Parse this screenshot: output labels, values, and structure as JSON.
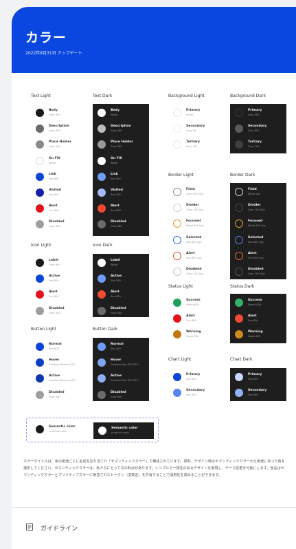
{
  "header": {
    "title": "カラー",
    "subtitle": "2022年8月31日 アップデート"
  },
  "groups": {
    "text_light": {
      "title": "Text Light"
    },
    "text_dark": {
      "title": "Text Dark"
    },
    "bg_light": {
      "title": "Background Light"
    },
    "bg_dark": {
      "title": "Background Dark"
    },
    "border_light": {
      "title": "Border Light"
    },
    "border_dark": {
      "title": "Border Dark"
    },
    "icon_light": {
      "title": "Icon Light"
    },
    "icon_dark": {
      "title": "Icon Dark"
    },
    "status_light": {
      "title": "Status Light"
    },
    "status_dark": {
      "title": "Status Dark"
    },
    "button_light": {
      "title": "Button Light"
    },
    "button_dark": {
      "title": "Button Dark"
    },
    "chart_light": {
      "title": "Chart Light"
    },
    "chart_dark": {
      "title": "Chart Dark"
    }
  },
  "swatches": {
    "text_light": [
      {
        "name": "Body",
        "sub": "Gray 900",
        "color": "#1a1a1a"
      },
      {
        "name": "Description",
        "sub": "Gray 600",
        "color": "#6b6b6b"
      },
      {
        "name": "Place Holder",
        "sub": "Gray 500",
        "color": "#8a8a8a"
      },
      {
        "name": "On Fill",
        "sub": "White",
        "color": "#ffffff",
        "ring": "#dddddd"
      },
      {
        "name": "Link",
        "sub": "Sea 800",
        "color": "#0b45d8"
      },
      {
        "name": "Visited",
        "sub": "Sea 900",
        "color": "#1520a8"
      },
      {
        "name": "Alert",
        "sub": "Sun 800",
        "color": "#e3131d"
      },
      {
        "name": "Disabled",
        "sub": "Gray 400",
        "color": "#9e9e9e"
      }
    ],
    "text_dark": [
      {
        "name": "Body",
        "sub": "White",
        "color": "#ffffff"
      },
      {
        "name": "Description",
        "sub": "Gray 400",
        "color": "#bdbdbd"
      },
      {
        "name": "Place Holder",
        "sub": "Gray 500",
        "color": "#9a9a9a"
      },
      {
        "name": "On Fill",
        "sub": "White",
        "color": "#ffffff"
      },
      {
        "name": "Link",
        "sub": "Sea 300",
        "color": "#6f9cf7"
      },
      {
        "name": "Visited",
        "sub": "Sea 200",
        "color": "#a6b9f7"
      },
      {
        "name": "Alert",
        "sub": "Sun 600",
        "color": "#f04b32"
      },
      {
        "name": "Disabled",
        "sub": "Gray 600",
        "color": "#6b6b6b"
      }
    ],
    "bg_light": [
      {
        "name": "Primary",
        "sub": "White",
        "color": "#ffffff",
        "ring": "#e6e6e6"
      },
      {
        "name": "Secondary",
        "sub": "Gray 50",
        "color": "#f5f5f5",
        "ring": "#eeeeee"
      },
      {
        "name": "Tertiary",
        "sub": "Gray 100",
        "color": "#eeeeee",
        "ring": "#e6e6e6"
      }
    ],
    "bg_dark": [
      {
        "name": "Primary",
        "sub": "Gray 900",
        "color": "#1e1e1e",
        "ring": "#3a3a3a"
      },
      {
        "name": "Secondary",
        "sub": "Gray 800",
        "color": "#5a5a5a"
      },
      {
        "name": "Tertiary",
        "sub": "Gray 700",
        "color": "#3f3f3f"
      }
    ],
    "border_light": [
      {
        "name": "Field",
        "sub": "Trans 600 Gys",
        "color": "#ffffff",
        "ring": "#8a8a8a"
      },
      {
        "name": "Divider",
        "sub": "Trans 300 Gys",
        "color": "#ffffff",
        "ring": "#d0d0d0"
      },
      {
        "name": "Focused",
        "sub": "Wood 600 Gys",
        "color": "#ffffff",
        "ring": "#d99a1e"
      },
      {
        "name": "Selected",
        "sub": "Sea 600 Gys",
        "color": "#ffffff",
        "ring": "#2f64e6"
      },
      {
        "name": "Alert",
        "sub": "Sun 600 Gys",
        "color": "#ffffff",
        "ring": "#e84a3a"
      },
      {
        "name": "Disabled",
        "sub": "Trans 300 Gys",
        "color": "#ffffff",
        "ring": "#c4c4c4"
      }
    ],
    "border_dark": [
      {
        "name": "Field",
        "sub": "White Gys",
        "color": "#1e1e1e",
        "ring": "#d0d0d0"
      },
      {
        "name": "Divider",
        "sub": "Gray 700 Gys",
        "color": "#1e1e1e",
        "ring": "#4a4a4a"
      },
      {
        "name": "Focused",
        "sub": "Wood 400 Gys",
        "color": "#1e1e1e",
        "ring": "#d8a431"
      },
      {
        "name": "Selected",
        "sub": "Sea 400 Gys",
        "color": "#1e1e1e",
        "ring": "#5a7fe6"
      },
      {
        "name": "Alert",
        "sub": "Sun 500 Gys",
        "color": "#1e1e1e",
        "ring": "#e0683f"
      },
      {
        "name": "Disabled",
        "sub": "Gray 700 Gys",
        "color": "#1e1e1e",
        "ring": "#555555"
      }
    ],
    "icon_light": [
      {
        "name": "Label",
        "sub": "Gray 900",
        "color": "#1a1a1a"
      },
      {
        "name": "Active",
        "sub": "Sea 800",
        "color": "#0b45d8"
      },
      {
        "name": "Alert",
        "sub": "Sun 800",
        "color": "#e3131d"
      },
      {
        "name": "Disabled",
        "sub": "Gray 400",
        "color": "#9e9e9e"
      }
    ],
    "icon_dark": [
      {
        "name": "Label",
        "sub": "White",
        "color": "#ffffff"
      },
      {
        "name": "Active",
        "sub": "Sea 300",
        "color": "#6f9cf7"
      },
      {
        "name": "Alert",
        "sub": "Sun 600",
        "color": "#f04b32"
      },
      {
        "name": "Disabled",
        "sub": "Gray 600",
        "color": "#6b6b6b"
      }
    ],
    "status_light": [
      {
        "name": "Success",
        "sub": "Forest 600",
        "color": "#1ca05c"
      },
      {
        "name": "Alert",
        "sub": "Sun 800",
        "color": "#e3131d"
      },
      {
        "name": "Warning",
        "sub": "Wood 600",
        "color": "#c5760f"
      }
    ],
    "status_dark": [
      {
        "name": "Success",
        "sub": "Forest 400",
        "color": "#2fb26a"
      },
      {
        "name": "Alert",
        "sub": "Sun 600",
        "color": "#f04b32"
      },
      {
        "name": "Warning",
        "sub": "Wood 400",
        "color": "#d08a1e"
      }
    ],
    "button_light": [
      {
        "name": "Normal",
        "sub": "Sea 800",
        "color": "#0b45d8"
      },
      {
        "name": "Hover",
        "sub": "Gradient Normal 20%",
        "color": "#0a3ec4"
      },
      {
        "name": "Active",
        "sub": "Gradient Normal 30%",
        "color": "#0a37b0"
      },
      {
        "name": "Disabled",
        "sub": "Gray 400",
        "color": "#9e9e9e"
      }
    ],
    "button_dark": [
      {
        "name": "Normal",
        "sub": "Sea 300",
        "color": "#6f9cf7"
      },
      {
        "name": "Hover",
        "sub": "Gradient Sea 300 20%",
        "color": "#7ea6f5"
      },
      {
        "name": "Active",
        "sub": "Gradient Sea 300 30%",
        "color": "#8caff2"
      },
      {
        "name": "Disabled",
        "sub": "Gray 600",
        "color": "#6b6b6b"
      }
    ],
    "chart_light": [
      {
        "name": "Primary",
        "sub": "Sea 800",
        "color": "#0b45d8"
      },
      {
        "name": "Secondary",
        "sub": "Sea 300",
        "color": "#5a86f0"
      }
    ],
    "chart_dark": [
      {
        "name": "Primary",
        "sub": "Sea 200",
        "color": "#c9d6fb"
      },
      {
        "name": "Secondary",
        "sub": "Sea 300",
        "color": "#8fb0f5"
      }
    ]
  },
  "semantic": {
    "light": {
      "name": "Semantic color",
      "sub": "primitive color",
      "color": "#1a1a1a"
    },
    "dark": {
      "name": "Semantic color",
      "sub": "primitive color",
      "color": "#ffffff"
    }
  },
  "paragraph": "カラータイトルは、色の用途ごとに名前を割り当てた「セマンティックカラー」で構成されています。原則、デザイン時はセマンティックカラーから用途にあった色を選択してください。セマンティックカラーは、私たちにとって次の利点があります。シンプルで一貫性のあるデザインを実現し、テーマ変更を可能にします。色名はセマンティックカラーとプリミティブカラーに用意されたトークン（変数名）を共有することで運用性を高めることができます。",
  "footer": {
    "guideline_label": "ガイドライン",
    "guideline_icon": "document-list-icon"
  }
}
